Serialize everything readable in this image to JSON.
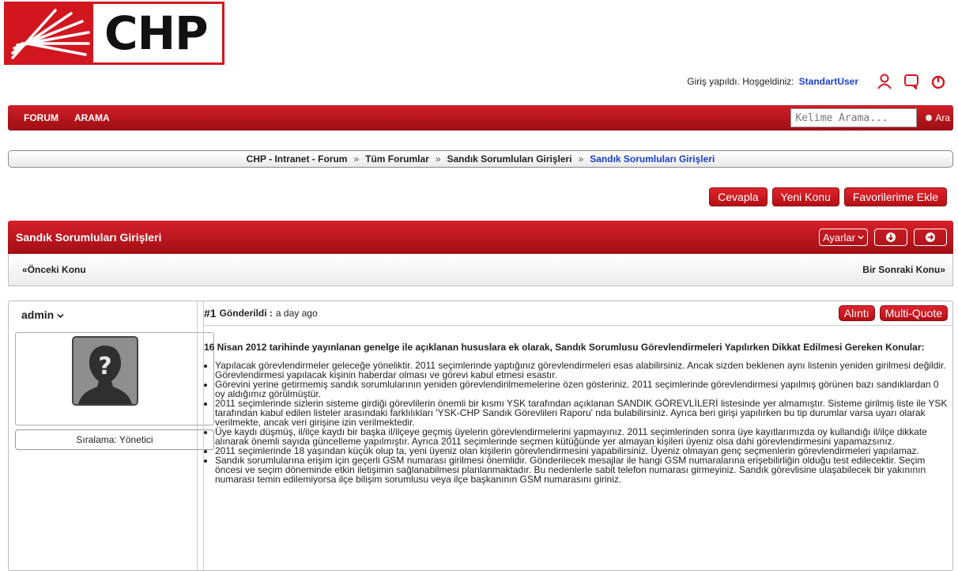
{
  "logo": {
    "text": "CHP"
  },
  "userbar": {
    "welcome": "Giriş yapıldı. Hoşgeldiniz:",
    "username": "StandartUser"
  },
  "nav": {
    "forum": "FORUM",
    "search": "ARAMA",
    "search_placeholder": "Kelime Arama...",
    "search_button": "Ara"
  },
  "breadcrumb": [
    "CHP - Intranet - Forum",
    "Tüm Forumlar",
    "Sandık Sorumluları Girişleri",
    "Sandık Sorumluları Girişleri"
  ],
  "actions": {
    "reply": "Cevapla",
    "new_topic": "Yeni Konu",
    "add_favorite": "Favorilerime Ekle"
  },
  "thread": {
    "title": "Sandık Sorumluları Girişleri",
    "settings": "Ayarlar",
    "prev": "Önceki Konu",
    "next": "Bir Sonraki Konu"
  },
  "post": {
    "author": "admin",
    "rank": "Sıralama: Yönetici",
    "number": "#1",
    "sent_label": "Gönderildi :",
    "time": "a day ago",
    "quote": "Alıntı",
    "multi_quote": "Multi-Quote",
    "lead": "16 Nisan 2012 tarihinde yayınlanan genelge ile açıklanan hususlara ek olarak, Sandık Sorumlusu Görevlendirmeleri Yapılırken Dikkat Edilmesi Gereken Konular:",
    "items": [
      "Yapılacak görevlendirmeler geleceğe yöneliktir. 2011 seçimlerinde yaptığınız görevlendirmeleri esas alabilirsiniz. Ancak sizden beklenen aynı listenin yeniden girilmesi değildir. Görevlendirmesi yapılacak kişinin haberdar olması ve görevi kabul etmesi esastır.",
      "Görevini yerine getirmemiş sandık sorumlularının yeniden görevlendirilmemelerine özen gösteriniz. 2011 seçimlerinde görevlendirmesi yapılmış görünen bazı sandıklardan 0 oy aldığımız görülmüştür.",
      "2011 seçimlerinde sizlerin sisteme girdiği görevlilerin önemli bir kısmı YSK tarafından açıklanan SANDIK GÖREVLİLERİ listesinde yer almamıştır. Sisteme girilmiş liste ile YSK tarafından kabul edilen listeler arasındaki farklılıkları 'YSK-CHP Sandık Görevlileri Raporu' nda bulabilirsiniz. Ayrıca beri girişi yapılırken bu tip durumlar varsa uyarı olarak verilmekte, ancak veri girişine izin verilmektedir.",
      "Üye kaydı düşmüş, il/ilçe kaydı bir başka il/ilçeye geçmiş üyelerin görevlendirmelerini yapmayınız. 2011 seçimlerinden sonra üye kayıtlarımızda oy kullandığı il/ilçe dikkate alınarak önemli sayıda güncelleme yapılmıştır. Ayrıca 2011 seçimlerinde seçmen kütüğünde yer almayan kişileri üyeniz olsa dahi görevlendirmesini yapamazsınız.",
      "2011 seçimlerinde 18 yaşından küçük olup ta, yeni üyeniz olan kişilerin görevlendirmesini yapabilirsiniz. Üyeniz olmayan genç seçmenlerin görevlendirmeleri yapılamaz.",
      "Sandık sorumlularına erişim için geçerli GSM numarası girilmesi önemlidir. Gönderilecek mesajlar ile hangi GSM numaralarına erişebilirliğin olduğu test edilecektir. Seçim öncesi ve seçim döneminde etkin iletişimin sağlanabilmesi planlanmaktadır. Bu nedenlerle sabit telefon numarası girmeyiniz. Sandık görevlisine ulaşabilecek bir yakınının numarası temin edilemiyorsa ilçe bilişim sorumlusu veya ilçe başkanının GSM numarasını giriniz."
    ]
  },
  "colors": {
    "brand_red": "#d2161e",
    "link_blue": "#1a3fd3"
  }
}
